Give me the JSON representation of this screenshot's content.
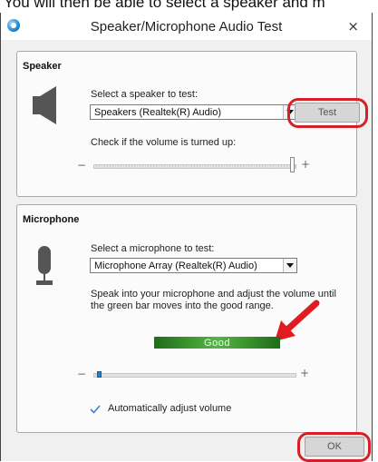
{
  "page": {
    "caption": "You will then be able to select a speaker and m"
  },
  "window": {
    "title": "Speaker/Microphone Audio Test",
    "close_glyph": "×"
  },
  "speaker": {
    "section_title": "Speaker",
    "select_label": "Select a speaker to test:",
    "selected_device": "Speakers (Realtek(R) Audio)",
    "test_button": "Test",
    "volume_label": "Check if the volume is turned up:",
    "volume_level": 1.0
  },
  "microphone": {
    "section_title": "Microphone",
    "select_label": "Select a microphone to test:",
    "selected_device": "Microphone Array (Realtek(R) Audio)",
    "instruction_line1": "Speak into your microphone and adjust the volume until",
    "instruction_line2": "the green bar moves into the good range.",
    "level_text": "Good",
    "volume_level": 0.02,
    "auto_adjust_label": "Automatically adjust volume",
    "auto_adjust_checked": true
  },
  "footer": {
    "ok_button": "OK"
  },
  "controls": {
    "minus": "−",
    "plus": "+"
  },
  "colors": {
    "callout": "#d71f26",
    "good_bar": "#3e9a2f",
    "arrow": "#e01b22"
  },
  "icons": {
    "speaker": "speaker-icon",
    "microphone": "microphone-icon",
    "app": "app-icon",
    "arrow": "annotation-arrow-icon",
    "check": "checkmark-icon"
  }
}
